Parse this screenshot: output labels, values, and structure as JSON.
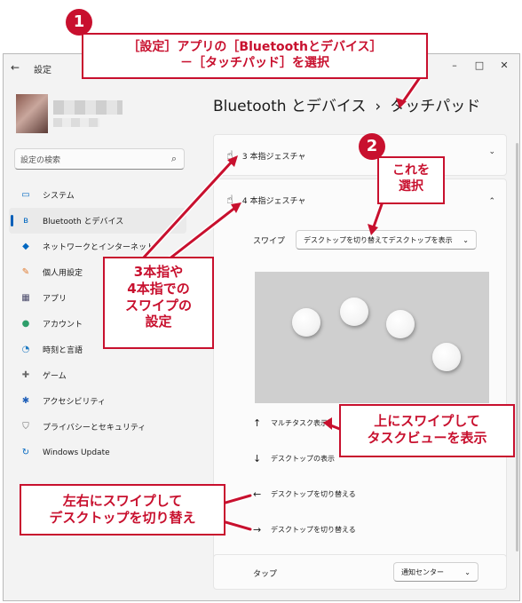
{
  "window": {
    "app_title": "設定",
    "back_icon": "back-arrow-icon",
    "controls": {
      "minimize": "–",
      "maximize": "□",
      "close": "✕"
    }
  },
  "search": {
    "placeholder": "設定の検索"
  },
  "sidebar": {
    "items": [
      {
        "label": "システム",
        "icon": "monitor-icon",
        "glyph": "▭",
        "color": "#0067c0"
      },
      {
        "label": "Bluetooth とデバイス",
        "icon": "bluetooth-icon",
        "glyph": "ʙ",
        "color": "#0067c0",
        "active": true
      },
      {
        "label": "ネットワークとインターネット",
        "icon": "wifi-icon",
        "glyph": "◆",
        "color": "#0067c0"
      },
      {
        "label": "個人用設定",
        "icon": "paint-brush-icon",
        "glyph": "✎",
        "color": "#e07a2e"
      },
      {
        "label": "アプリ",
        "icon": "apps-icon",
        "glyph": "▦",
        "color": "#4a4a6a"
      },
      {
        "label": "アカウント",
        "icon": "person-icon",
        "glyph": "●",
        "color": "#2e9e6a"
      },
      {
        "label": "時刻と言語",
        "icon": "clock-globe-icon",
        "glyph": "◔",
        "color": "#1f7ac2"
      },
      {
        "label": "ゲーム",
        "icon": "gamepad-icon",
        "glyph": "✚",
        "color": "#6a6a6a"
      },
      {
        "label": "アクセシビリティ",
        "icon": "accessibility-icon",
        "glyph": "✱",
        "color": "#1f5fb8"
      },
      {
        "label": "プライバシーとセキュリティ",
        "icon": "shield-icon",
        "glyph": "⛉",
        "color": "#6a6a6a"
      },
      {
        "label": "Windows Update",
        "icon": "update-icon",
        "glyph": "↻",
        "color": "#0067c0"
      }
    ]
  },
  "main": {
    "breadcrumb_parent": "Bluetooth とデバイス",
    "breadcrumb_sep": "›",
    "breadcrumb_current": "タッチパッド",
    "three_finger": {
      "label": "3 本指ジェスチャ",
      "chevron": "⌄"
    },
    "four_finger": {
      "label": "4 本指ジェスチャ",
      "chevron": "⌃",
      "swipe_label": "スワイプ",
      "swipe_value": "デスクトップを切り替えてデスクトップを表示",
      "gestures": [
        {
          "arrow": "↑",
          "label": "マルチタスク表示"
        },
        {
          "arrow": "↓",
          "label": "デスクトップの表示"
        },
        {
          "arrow": "←",
          "label": "デスクトップを切り替える"
        },
        {
          "arrow": "→",
          "label": "デスクトップを切り替える"
        }
      ]
    },
    "tap": {
      "label": "タップ",
      "value": "通知センター"
    }
  },
  "annotations": {
    "badge1": "1",
    "badge2": "2",
    "top_line1": "［設定］アプリの［Bluetoothとデバイス］",
    "top_line2": "－［タッチパッド］を選択",
    "select_line1": "これを",
    "select_line2": "選択",
    "fingers_line1": "3本指や",
    "fingers_line2": "4本指での",
    "fingers_line3": "スワイプの",
    "fingers_line4": "設定",
    "task_line1": "上にスワイプして",
    "task_line2": "タスクビューを表示",
    "switch_line1": "左右にスワイプして",
    "switch_line2": "デスクトップを切り替え",
    "accent_color": "#c8102e"
  }
}
